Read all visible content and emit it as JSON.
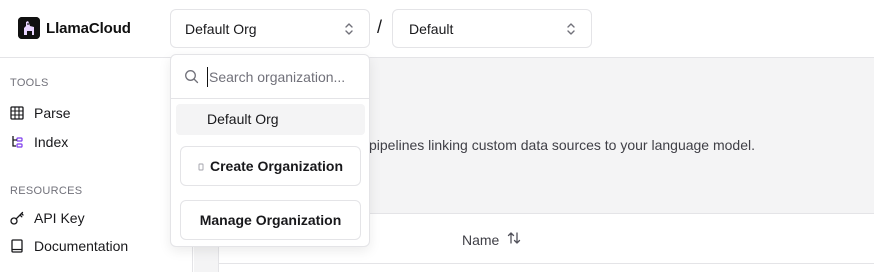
{
  "header": {
    "logo_text": "LlamaCloud",
    "org_selector": {
      "value": "Default Org"
    },
    "separator": "/",
    "project_selector": {
      "value": "Default"
    }
  },
  "dropdown": {
    "search_placeholder": "Search organization...",
    "options": [
      "Default Org"
    ],
    "create_label": "Create Organization",
    "manage_label": "Manage Organization"
  },
  "sidebar": {
    "sections": [
      {
        "title": "TOOLS",
        "items": [
          {
            "label": "Parse",
            "icon": "grid-icon"
          },
          {
            "label": "Index",
            "icon": "index-icon"
          }
        ]
      },
      {
        "title": "RESOURCES",
        "items": [
          {
            "label": "API Key",
            "icon": "key-icon"
          },
          {
            "label": "Documentation",
            "icon": "book-icon"
          }
        ]
      }
    ]
  },
  "main": {
    "description": "pipelines linking custom data sources to your language model.",
    "table": {
      "columns": [
        "Name"
      ]
    }
  },
  "colors": {
    "accent": "#18181b",
    "index_icon": "#7c3aed",
    "muted_bg": "#f4f4f5",
    "border": "#e4e4e7"
  }
}
